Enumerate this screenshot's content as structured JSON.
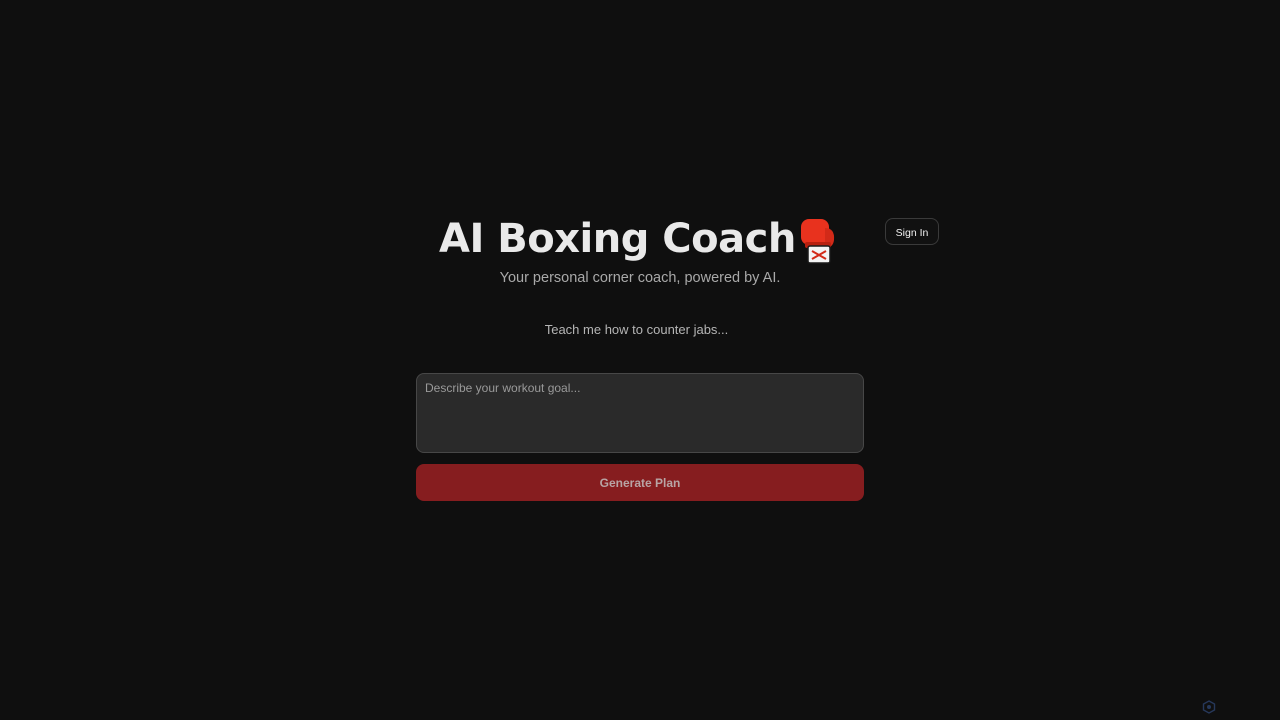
{
  "header": {
    "title": "AI Boxing Coach",
    "title_icon": "boxing-glove-icon",
    "subtitle": "Your personal corner coach, powered by AI.",
    "sign_in_label": "Sign In"
  },
  "main": {
    "prompt_hint": "Teach me how to counter jabs...",
    "goal_input": {
      "value": "",
      "placeholder": "Describe your workout goal..."
    },
    "generate_label": "Generate Plan"
  },
  "colors": {
    "background": "#0f0f0f",
    "accent": "#861d1f",
    "glove": "#e8321e"
  },
  "badge": {
    "icon": "hexagon-logo-icon"
  }
}
